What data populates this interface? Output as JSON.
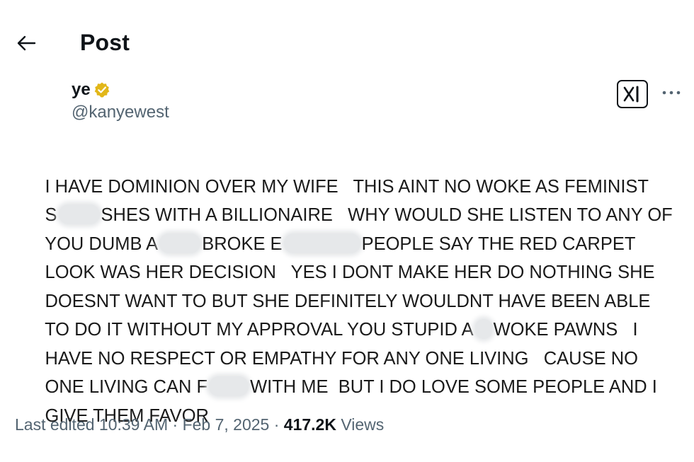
{
  "header": {
    "back_icon": "arrow-left-icon",
    "title": "Post"
  },
  "author": {
    "display_name": "ye",
    "verified_icon": "verified-badge-icon",
    "verified_color": "#e2b719",
    "handle": "@kanyewest"
  },
  "actions": {
    "grok_icon": "grok-icon",
    "more_icon": "more-options-icon"
  },
  "post": {
    "lines": [
      [
        "I HAVE DOMINION OVER MY WIFE   THIS AINT NO WOKE AS FEMINIST"
      ],
      [
        "S",
        "SHES WITH A BILLIONAIRE   WHY WOULD SHE LISTEN TO ANY OF"
      ],
      [
        "YOU DUMB A",
        "BROKE E",
        "PEOPLE SAY THE RED CARPET"
      ],
      [
        "LOOK WAS HER DECISION   YES I DONT MAKE HER DO NOTHING SHE"
      ],
      [
        "DOESNT WANT TO BUT SHE DEFINITELY WOULDNT HAVE BEEN ABLE"
      ],
      [
        "TO DO IT WITHOUT MY APPROVAL YOU STUPID A",
        "WOKE PAWNS   I"
      ],
      [
        "HAVE NO RESPECT OR EMPATHY FOR ANY ONE LIVING   CAUSE NO"
      ],
      [
        "ONE LIVING CAN F",
        "WITH ME  BUT I DO LOVE SOME PEOPLE AND I"
      ],
      [
        "GIVE THEM FAVOR"
      ]
    ]
  },
  "meta": {
    "edited_label": "Last edited",
    "time": "10:39 AM",
    "separator": "·",
    "date": "Feb 7, 2025",
    "views_count": "417.2K",
    "views_label": "Views"
  },
  "colors": {
    "text": "#0f1419",
    "secondary": "#536471",
    "background": "#ffffff"
  }
}
